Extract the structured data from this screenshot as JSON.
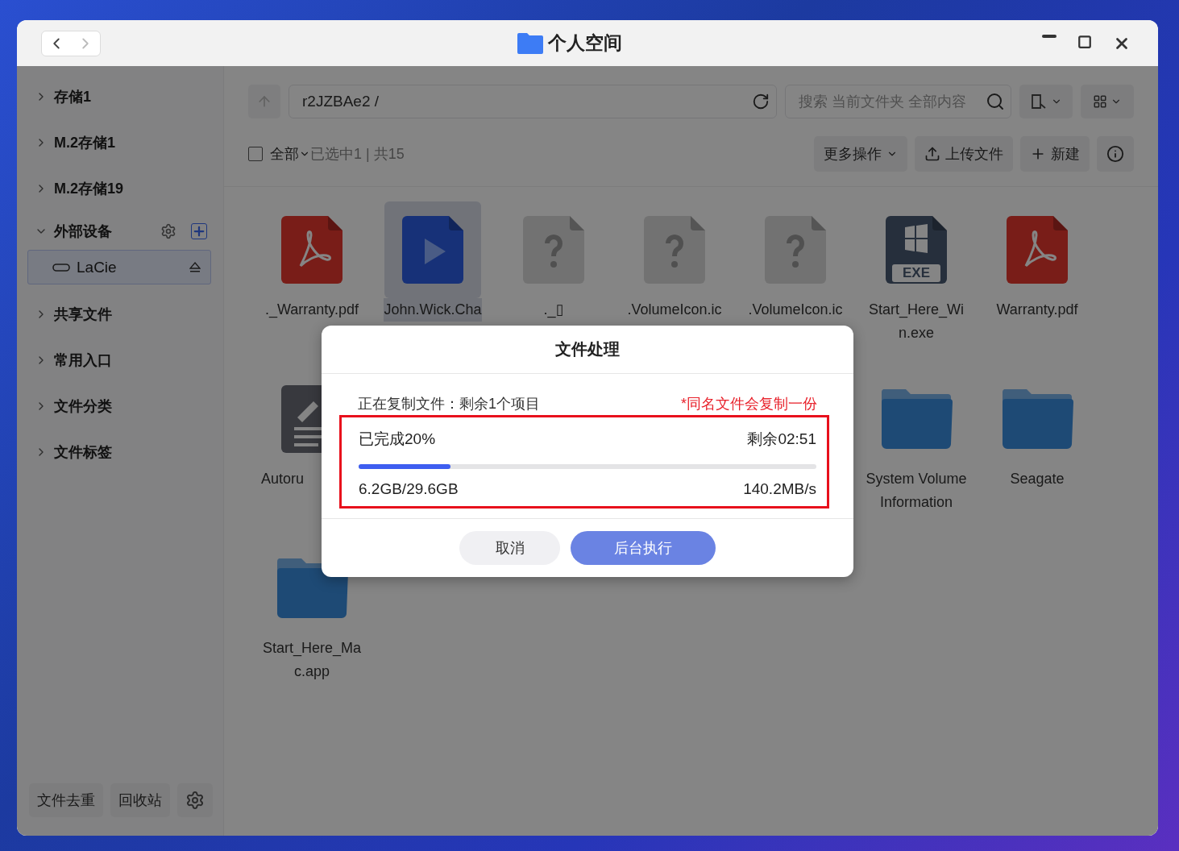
{
  "window": {
    "title": "个人空间"
  },
  "sidebar": {
    "items": [
      {
        "label": "存储1",
        "expanded": false
      },
      {
        "label": "M.2存储1",
        "expanded": false
      },
      {
        "label": "M.2存储19",
        "expanded": false
      },
      {
        "label": "外部设备",
        "expanded": true,
        "children": [
          {
            "label": "LaCie",
            "selected": true
          }
        ]
      },
      {
        "label": "共享文件",
        "expanded": false
      },
      {
        "label": "常用入口",
        "expanded": false
      },
      {
        "label": "文件分类",
        "expanded": false
      },
      {
        "label": "文件标签",
        "expanded": false
      }
    ],
    "footer_buttons": [
      "文件去重",
      "回收站"
    ]
  },
  "toolbar": {
    "path": "r2JZBAe2 /",
    "search": {
      "placeholder": "搜索 当前文件夹 全部内容"
    }
  },
  "selection_bar": {
    "select_all": {
      "label": "全部",
      "checked": false
    },
    "summary": "已选中1 | 共15",
    "actions": [
      {
        "kind": "menu",
        "label": "更多操作"
      },
      {
        "kind": "upload",
        "label": "上传文件"
      },
      {
        "kind": "new",
        "label": "新建"
      },
      {
        "kind": "info"
      }
    ]
  },
  "file_rows": [
    {
      "left": [
        {
          "kind": "pdf",
          "name": "._Warranty.pdf",
          "selected": false
        },
        {
          "kind": "video",
          "name": "John.Wick.Cha",
          "selected": true
        },
        {
          "kind": "unknown",
          "name": "._▯",
          "selected": false
        },
        {
          "kind": "unknown",
          "name": ".VolumeIcon.ic",
          "selected": false
        },
        {
          "kind": "unknown",
          "name": ".VolumeIcon.ic",
          "selected": false
        },
        {
          "kind": "exe",
          "name": "Start_Here_Wi n.exe",
          "badge": "EXE",
          "selected": false
        },
        {
          "kind": "pdf",
          "name": "Warranty.pdf",
          "selected": false
        }
      ],
      "right": []
    },
    {
      "left": [
        {
          "kind": "doc",
          "name": "Autoru",
          "selected": false
        }
      ],
      "right": [
        {
          "kind": "folder",
          "name": "System Volume Information",
          "selected": false
        },
        {
          "kind": "folder",
          "name": "Seagate",
          "selected": false
        }
      ]
    },
    {
      "left": [
        {
          "kind": "folder",
          "name": "Start_Here_Ma c.app",
          "selected": false
        }
      ],
      "right": []
    }
  ],
  "dialog": {
    "title": "文件处理",
    "status": "正在复制文件：剩余1个项目",
    "note": "*同名文件会复制一份",
    "progress": {
      "highlighted": true,
      "done": "已完成20%",
      "remaining": "剩余02:51",
      "level": 0.2,
      "size": "6.2GB/29.6GB",
      "speed": "140.2MB/s"
    },
    "buttons": [
      {
        "kind": "secondary",
        "label": "取消"
      },
      {
        "kind": "primary",
        "label": "后台执行"
      }
    ]
  }
}
